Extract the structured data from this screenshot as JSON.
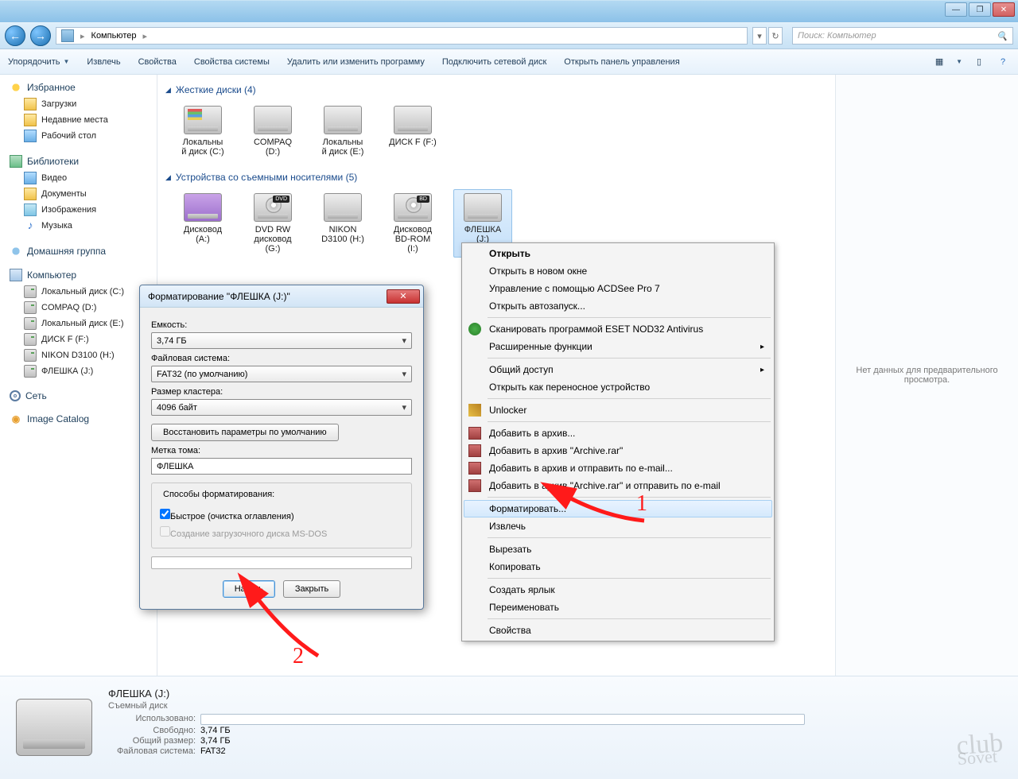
{
  "window": {
    "min": "—",
    "max": "❐",
    "close": "✕"
  },
  "nav": {
    "computer": "Компьютер",
    "search_placeholder": "Поиск: Компьютер"
  },
  "toolbar": {
    "organize": "Упорядочить",
    "extract": "Извлечь",
    "props": "Свойства",
    "sysprops": "Свойства системы",
    "uninstall": "Удалить или изменить программу",
    "netdrive": "Подключить сетевой диск",
    "cpanel": "Открыть панель управления"
  },
  "sidebar": {
    "fav": "Избранное",
    "fav_items": [
      "Загрузки",
      "Недавние места",
      "Рабочий стол"
    ],
    "lib": "Библиотеки",
    "lib_items": [
      "Видео",
      "Документы",
      "Изображения",
      "Музыка"
    ],
    "home": "Домашняя группа",
    "comp": "Компьютер",
    "comp_items": [
      "Локальный диск (C:)",
      "COMPAQ (D:)",
      "Локальный диск (E:)",
      "ДИСК F (F:)",
      "NIKON D3100 (H:)",
      "ФЛЕШКА (J:)"
    ],
    "net": "Сеть",
    "imgcat": "Image Catalog"
  },
  "groups": {
    "hdd": "Жесткие диски (4)",
    "hdd_items": [
      {
        "l1": "Локальны",
        "l2": "й диск (C:)"
      },
      {
        "l1": "COMPAQ",
        "l2": "(D:)"
      },
      {
        "l1": "Локальны",
        "l2": "й диск (E:)"
      },
      {
        "l1": "ДИСК F (F:)",
        "l2": ""
      }
    ],
    "rem": "Устройства со съемными носителями (5)",
    "rem_items": [
      {
        "l1": "Дисковод",
        "l2": "(A:)"
      },
      {
        "l1": "DVD RW",
        "l2": "дисковод",
        "l3": "(G:)"
      },
      {
        "l1": "NIKON",
        "l2": "D3100 (H:)"
      },
      {
        "l1": "Дисковод",
        "l2": "BD-ROM",
        "l3": "(I:)"
      },
      {
        "l1": "ФЛЕШКА",
        "l2": "(J:)"
      }
    ]
  },
  "preview": "Нет данных для предварительного просмотра.",
  "ctx": {
    "open": "Открыть",
    "open_new": "Открыть в новом окне",
    "acdsee": "Управление с помощью ACDSee Pro 7",
    "autoplay": "Открыть автозапуск...",
    "eset": "Сканировать программой ESET NOD32 Antivirus",
    "ext": "Расширенные функции",
    "share": "Общий доступ",
    "portable": "Открыть как переносное устройство",
    "unlocker": "Unlocker",
    "r1": "Добавить в архив...",
    "r2": "Добавить в архив \"Archive.rar\"",
    "r3": "Добавить в архив и отправить по e-mail...",
    "r4": "Добавить в архив \"Archive.rar\" и отправить по e-mail",
    "format": "Форматировать...",
    "eject": "Извлечь",
    "cut": "Вырезать",
    "copy": "Копировать",
    "shortcut": "Создать ярлык",
    "rename": "Переименовать",
    "properties": "Свойства"
  },
  "dlg": {
    "title": "Форматирование \"ФЛЕШКА (J:)\"",
    "cap_l": "Емкость:",
    "cap": "3,74 ГБ",
    "fs_l": "Файловая система:",
    "fs": "FAT32 (по умолчанию)",
    "cl_l": "Размер кластера:",
    "cl": "4096 байт",
    "restore": "Восстановить параметры по умолчанию",
    "vol_l": "Метка тома:",
    "vol": "ФЛЕШКА",
    "ways": "Способы форматирования:",
    "quick": "Быстрое (очистка оглавления)",
    "msdos": "Создание загрузочного диска MS-DOS",
    "start": "Начать",
    "close": "Закрыть"
  },
  "details": {
    "name": "ФЛЕШКА (J:)",
    "type": "Съемный диск",
    "used_l": "Использовано:",
    "free_l": "Свободно:",
    "free": "3,74 ГБ",
    "total_l": "Общий размер:",
    "total": "3,74 ГБ",
    "fs_l": "Файловая система:",
    "fs": "FAT32"
  },
  "annot": {
    "n1": "1",
    "n2": "2"
  },
  "wm": {
    "a": "club",
    "b": "Sovet"
  }
}
